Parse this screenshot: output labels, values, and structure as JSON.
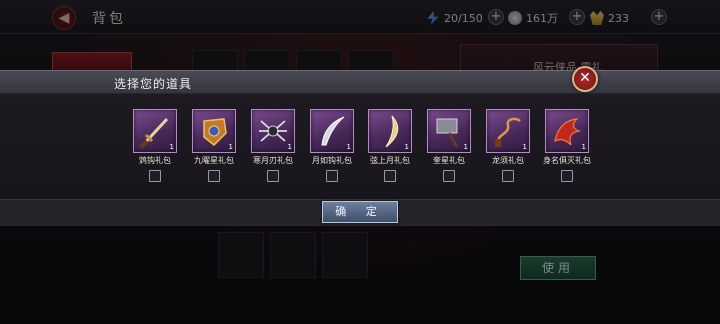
{
  "header": {
    "back_icon": "back-arrow-icon",
    "title": "背包"
  },
  "resources": {
    "energy": {
      "icon": "energy-bolt-icon",
      "value": "20/150"
    },
    "silver": {
      "icon": "silver-coin-icon",
      "value": "161万"
    },
    "gold": {
      "icon": "gold-ingot-icon",
      "value": "233"
    },
    "plus_label": "+"
  },
  "background": {
    "right_panel_text": "风云侠品·霸礼",
    "use_button": "使用"
  },
  "modal": {
    "title": "选择您的道具",
    "close_label": "✕",
    "confirm_button": "确 定",
    "items": [
      {
        "name": "鸩钩礼包",
        "count": "1",
        "icon": "sword-icon"
      },
      {
        "name": "九曜星礼包",
        "count": "1",
        "icon": "armor-icon"
      },
      {
        "name": "寒月刃礼包",
        "count": "1",
        "icon": "spider-claw-icon"
      },
      {
        "name": "月如钩礼包",
        "count": "1",
        "icon": "curved-blade-icon"
      },
      {
        "name": "弦上月礼包",
        "count": "1",
        "icon": "crescent-blade-icon"
      },
      {
        "name": "奎星礼包",
        "count": "1",
        "icon": "hammer-icon"
      },
      {
        "name": "龙须礼包",
        "count": "1",
        "icon": "whip-icon"
      },
      {
        "name": "身名俱灭礼包",
        "count": "1",
        "icon": "dragon-claw-icon"
      }
    ]
  },
  "colors": {
    "item_tile": "#7c4b8f",
    "confirm_button": "#5a6b88",
    "use_button": "#2f6f52",
    "close_button": "#b32a2a"
  }
}
